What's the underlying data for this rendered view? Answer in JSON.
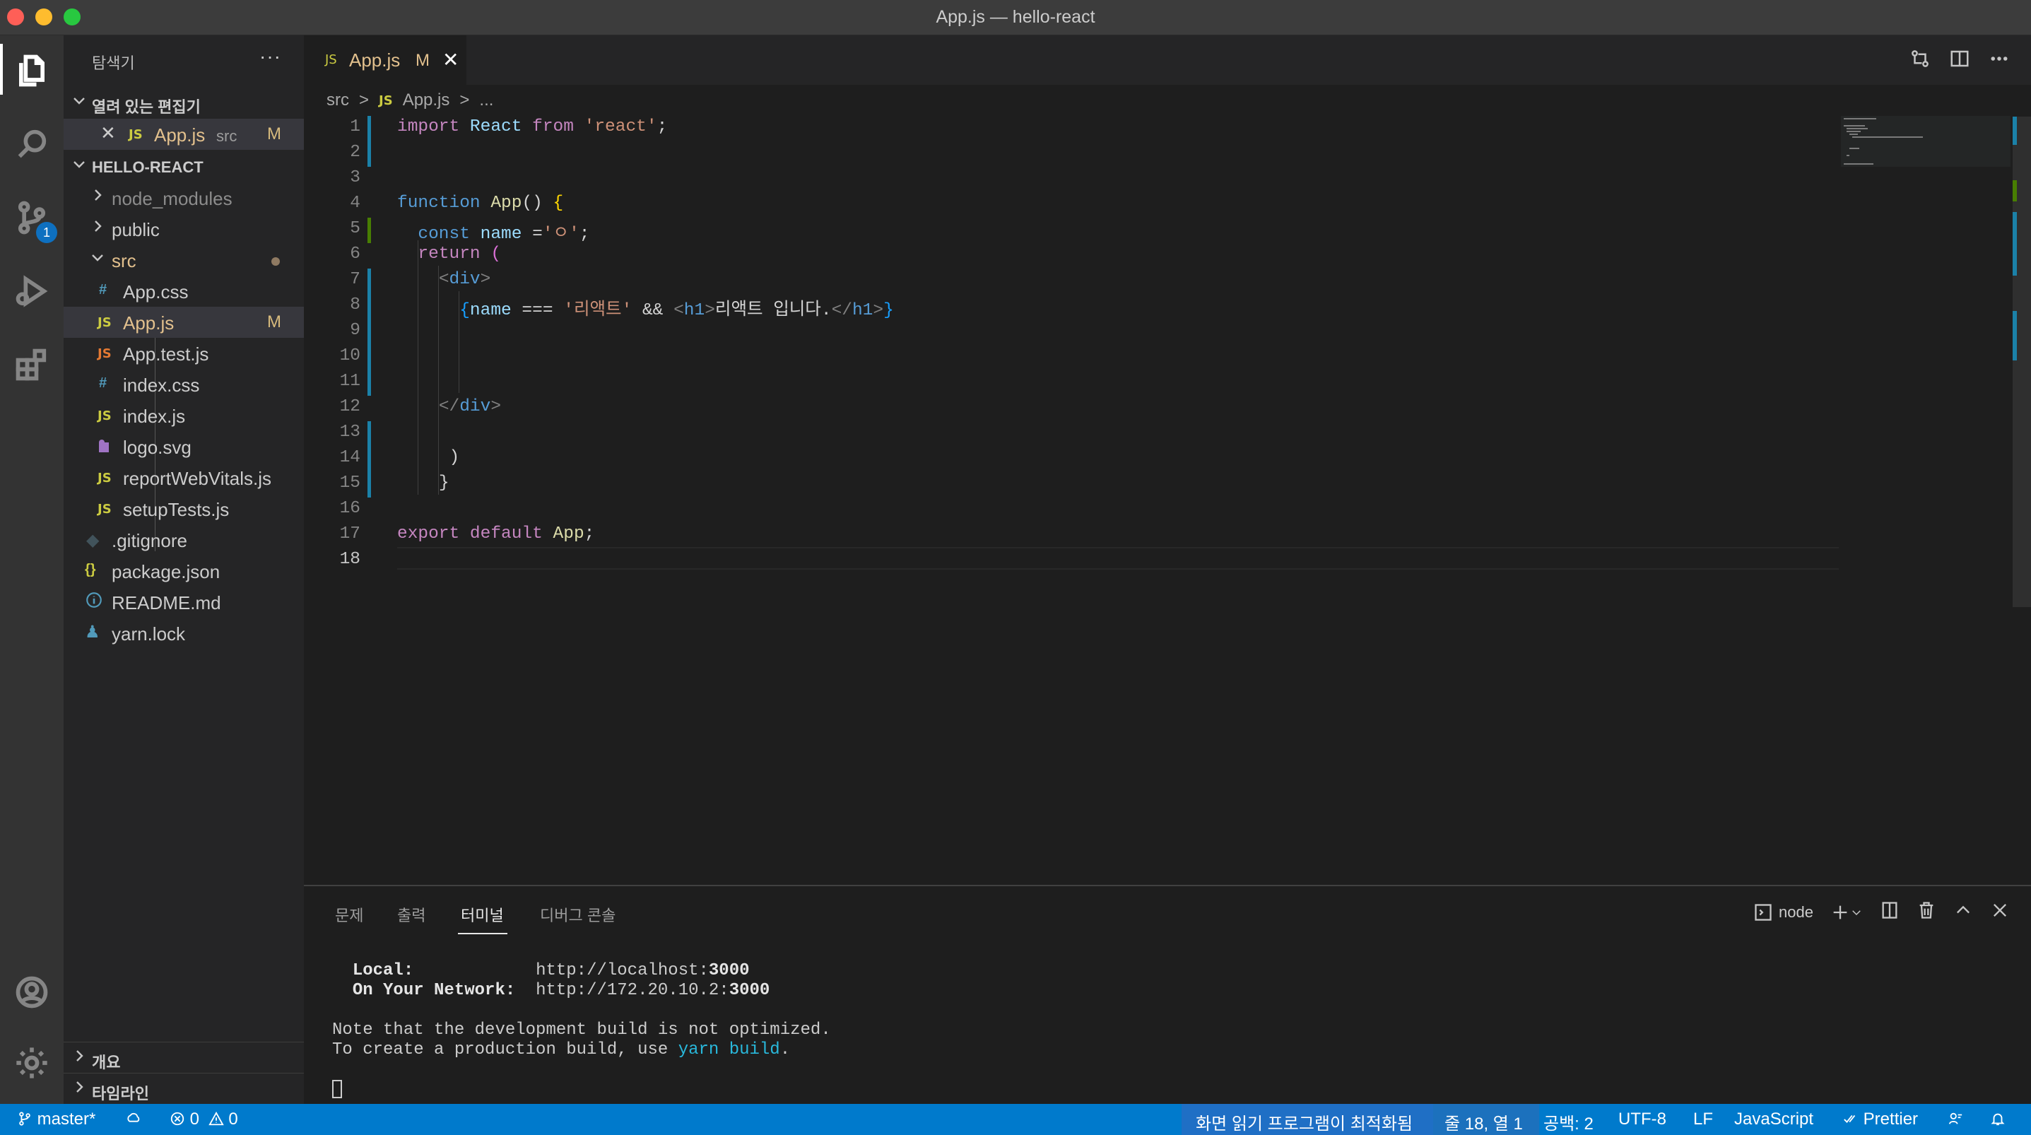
{
  "window": {
    "title": "App.js — hello-react"
  },
  "activity_bar": {
    "items": [
      "explorer-icon",
      "search-icon",
      "source-control-icon",
      "run-debug-icon",
      "extensions-icon"
    ],
    "scm_badge": "1",
    "bottom": [
      "account-icon",
      "manage-gear-icon"
    ]
  },
  "sidebar": {
    "title": "탐색기",
    "more": "···",
    "open_editors": {
      "label": "열려 있는 편집기",
      "items": [
        {
          "icon": "JS",
          "name": "App.js",
          "dir": "src",
          "status": "M"
        }
      ]
    },
    "project": {
      "label": "HELLO-REACT",
      "items": [
        {
          "name": "node_modules",
          "kind": "folder"
        },
        {
          "name": "public",
          "kind": "folder"
        },
        {
          "name": "src",
          "kind": "folder-open"
        },
        {
          "name": "App.css",
          "icon": "#"
        },
        {
          "name": "App.js",
          "icon": "JS",
          "status": "M"
        },
        {
          "name": "App.test.js",
          "icon": "JS"
        },
        {
          "name": "index.css",
          "icon": "#"
        },
        {
          "name": "index.js",
          "icon": "JS"
        },
        {
          "name": "logo.svg",
          "icon": "svg"
        },
        {
          "name": "reportWebVitals.js",
          "icon": "JS"
        },
        {
          "name": "setupTests.js",
          "icon": "JS"
        },
        {
          "name": ".gitignore",
          "icon": "git"
        },
        {
          "name": "package.json",
          "icon": "{}"
        },
        {
          "name": "README.md",
          "icon": "info"
        },
        {
          "name": "yarn.lock",
          "icon": "yarn"
        }
      ]
    },
    "outline_label": "개요",
    "timeline_label": "타임라인"
  },
  "editor": {
    "tab": {
      "icon": "JS",
      "name": "App.js",
      "status": "M"
    },
    "breadcrumb": [
      "src",
      ">",
      "JS",
      "App.js",
      ">",
      "..."
    ],
    "line_numbers": [
      "1",
      "2",
      "3",
      "4",
      "5",
      "6",
      "7",
      "8",
      "9",
      "10",
      "11",
      "12",
      "13",
      "14",
      "15",
      "16",
      "17",
      "18"
    ],
    "current_line": "18",
    "code": {
      "l1": [
        "import",
        " ",
        "React",
        " ",
        "from",
        " ",
        "'react'",
        ";"
      ],
      "l4": [
        "function",
        " ",
        "App",
        "() ",
        "{"
      ],
      "l5": [
        "const",
        " ",
        "name",
        " =",
        "'ㅇ'",
        ";"
      ],
      "l6": [
        "return",
        " ",
        "("
      ],
      "l7": [
        "<",
        "div",
        ">"
      ],
      "l8": [
        "{",
        "name",
        " === ",
        "'리액트'",
        " && ",
        "<",
        "h1",
        ">",
        "리액트 입니다.",
        "</",
        "h1",
        ">",
        "}"
      ],
      "l12": [
        "</",
        "div",
        ">"
      ],
      "l14": [
        ")"
      ],
      "l15": [
        "}"
      ],
      "l17": [
        "export",
        " ",
        "default",
        " ",
        "App",
        ";"
      ]
    }
  },
  "panel": {
    "tabs": [
      "문제",
      "출력",
      "터미널",
      "디버그 콘솔"
    ],
    "active_tab": "터미널",
    "shell": "node",
    "terminal": {
      "local_label": "Local:",
      "local_url_prefix": "http://localhost:",
      "local_port": "3000",
      "network_label": "On Your Network:",
      "network_url_prefix": "http://172.20.10.2:",
      "network_port": "3000",
      "note1": "Note that the development build is not optimized.",
      "note2_prefix": "To create a production build, use ",
      "note2_cmd": "yarn build",
      "note2_suffix": "."
    }
  },
  "status_bar": {
    "branch": "master*",
    "errors": "0",
    "warnings": "0",
    "a11y": "화면 읽기 프로그램이 최적화됨",
    "cursor": "줄 18, 열 1",
    "spaces": "공백: 2",
    "encoding": "UTF-8",
    "eol": "LF",
    "language": "JavaScript",
    "formatter": "Prettier"
  },
  "colors": {
    "accent": "#007acc",
    "modified": "#e2c08d",
    "js_icon": "#cbcb41"
  }
}
